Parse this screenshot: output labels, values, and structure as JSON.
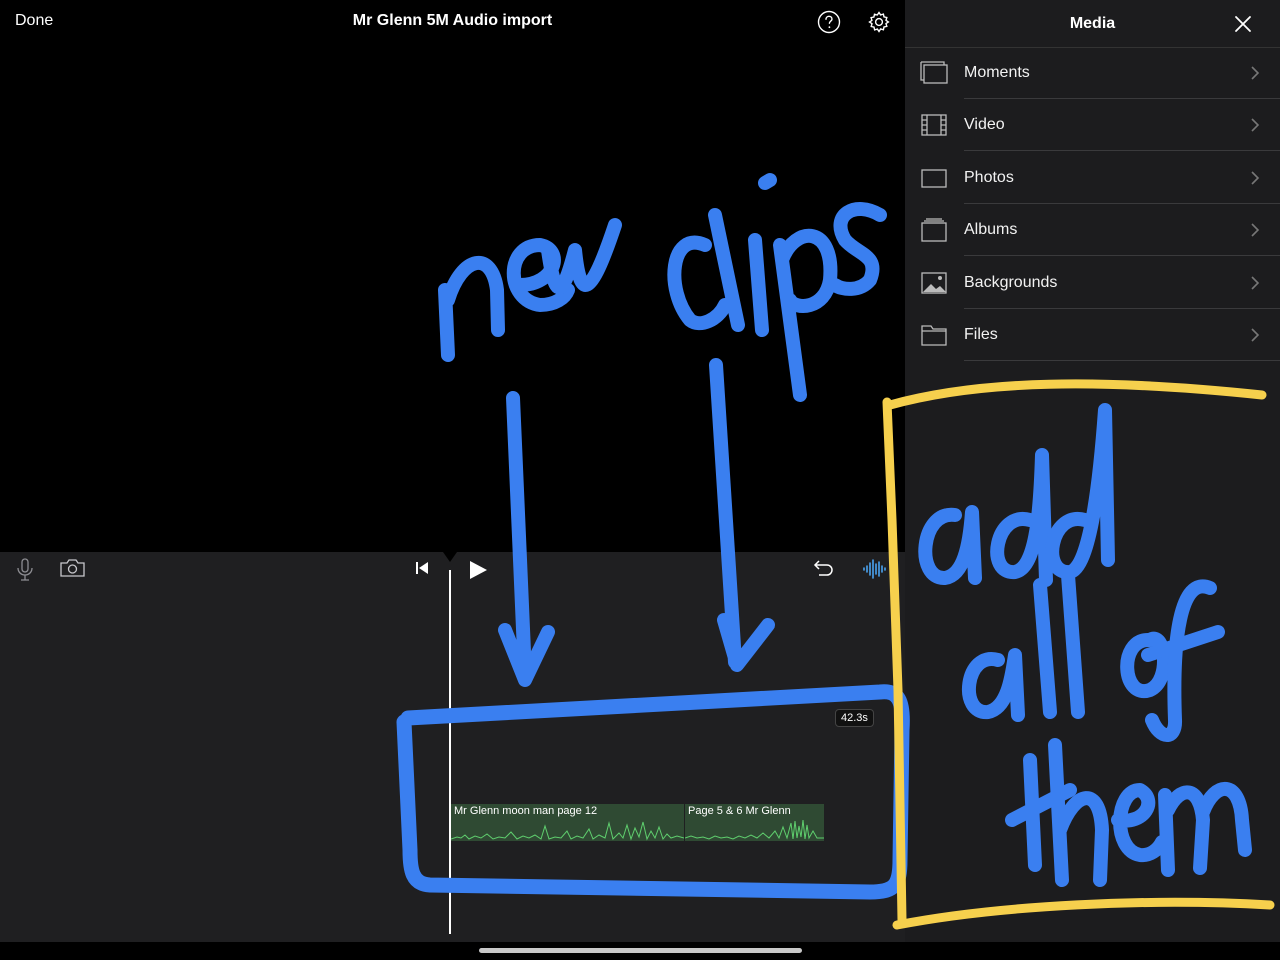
{
  "topbar": {
    "done_label": "Done",
    "project_title": "Mr Glenn 5M Audio import",
    "help_icon": "help-icon",
    "settings_icon": "gear-icon"
  },
  "media_panel": {
    "title": "Media",
    "close_icon": "close-icon",
    "items": [
      {
        "label": "Moments",
        "icon": "moments-icon"
      },
      {
        "label": "Video",
        "icon": "film-icon"
      },
      {
        "label": "Photos",
        "icon": "photos-icon"
      },
      {
        "label": "Albums",
        "icon": "albums-icon"
      },
      {
        "label": "Backgrounds",
        "icon": "image-icon"
      },
      {
        "label": "Files",
        "icon": "folder-icon"
      }
    ]
  },
  "timeline": {
    "duration": "42.3s",
    "clips": [
      {
        "label": "Mr Glenn moon man page 12"
      },
      {
        "label": "Page 5 & 6 Mr Glenn"
      }
    ],
    "icons": [
      "microphone-icon",
      "camera-icon",
      "skip-to-start-icon",
      "play-icon",
      "undo-icon",
      "waveform-icon"
    ]
  },
  "annotations": {
    "texts": [
      "new clips",
      "add all of them"
    ],
    "colors": {
      "blue": "#3a7ff0",
      "yellow": "#f6d04d"
    }
  },
  "colors": {
    "panel_bg": "#1c1c1e",
    "timeline_bg": "#1f1f21",
    "clip_bg": "#2f4a33",
    "waveform": "#5fcf6e",
    "accent_waveform_icon": "#4aa3f0"
  }
}
